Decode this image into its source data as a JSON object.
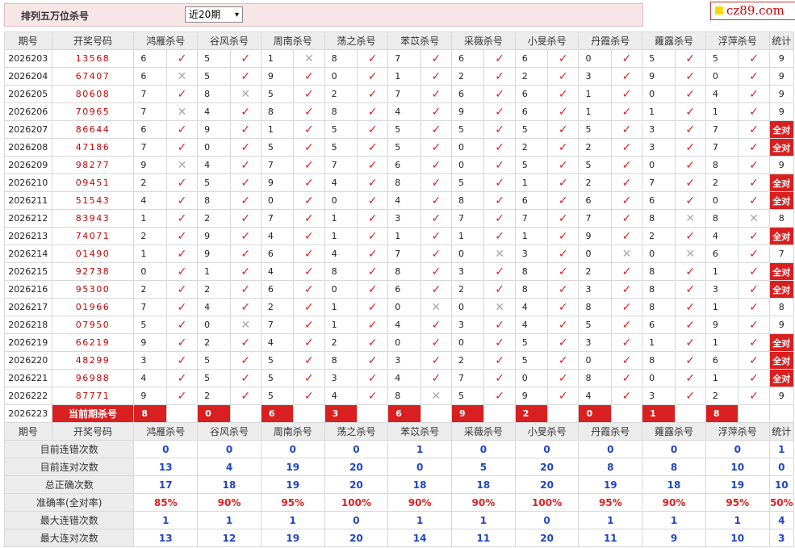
{
  "header": {
    "title": "排列五万位杀号",
    "period_select": "近20期",
    "logo_text": "cz89.com"
  },
  "columns": [
    "期号",
    "开奖号码",
    "鸿雁杀号",
    "谷风杀号",
    "周南杀号",
    "荡之杀号",
    "苯苡杀号",
    "采薇杀号",
    "小旻杀号",
    "丹霞杀号",
    "蕹露杀号",
    "浮萍杀号",
    "统计"
  ],
  "rows": [
    {
      "p": "2026203",
      "n": "13568",
      "k": [
        [
          6,
          1
        ],
        [
          5,
          1
        ],
        [
          1,
          0
        ],
        [
          8,
          1
        ],
        [
          7,
          1
        ],
        [
          6,
          1
        ],
        [
          6,
          1
        ],
        [
          0,
          1
        ],
        [
          5,
          1
        ],
        [
          5,
          1
        ]
      ],
      "s": "9"
    },
    {
      "p": "2026204",
      "n": "67407",
      "k": [
        [
          6,
          0
        ],
        [
          5,
          1
        ],
        [
          9,
          1
        ],
        [
          0,
          1
        ],
        [
          1,
          1
        ],
        [
          2,
          1
        ],
        [
          2,
          1
        ],
        [
          3,
          1
        ],
        [
          9,
          1
        ],
        [
          0,
          1
        ]
      ],
      "s": "9"
    },
    {
      "p": "2026205",
      "n": "80608",
      "k": [
        [
          7,
          1
        ],
        [
          8,
          0
        ],
        [
          5,
          1
        ],
        [
          2,
          1
        ],
        [
          7,
          1
        ],
        [
          6,
          1
        ],
        [
          6,
          1
        ],
        [
          1,
          1
        ],
        [
          0,
          1
        ],
        [
          4,
          1
        ]
      ],
      "s": "9"
    },
    {
      "p": "2026206",
      "n": "70965",
      "k": [
        [
          7,
          0
        ],
        [
          4,
          1
        ],
        [
          8,
          1
        ],
        [
          8,
          1
        ],
        [
          4,
          1
        ],
        [
          9,
          1
        ],
        [
          6,
          1
        ],
        [
          1,
          1
        ],
        [
          1,
          1
        ],
        [
          1,
          1
        ]
      ],
      "s": "9"
    },
    {
      "p": "2026207",
      "n": "86644",
      "k": [
        [
          6,
          1
        ],
        [
          9,
          1
        ],
        [
          1,
          1
        ],
        [
          5,
          1
        ],
        [
          5,
          1
        ],
        [
          5,
          1
        ],
        [
          5,
          1
        ],
        [
          5,
          1
        ],
        [
          3,
          1
        ],
        [
          7,
          1
        ]
      ],
      "s": "全对"
    },
    {
      "p": "2026208",
      "n": "47186",
      "k": [
        [
          7,
          1
        ],
        [
          0,
          1
        ],
        [
          5,
          1
        ],
        [
          5,
          1
        ],
        [
          5,
          1
        ],
        [
          0,
          1
        ],
        [
          2,
          1
        ],
        [
          2,
          1
        ],
        [
          3,
          1
        ],
        [
          7,
          1
        ]
      ],
      "s": "全对"
    },
    {
      "p": "2026209",
      "n": "98277",
      "k": [
        [
          9,
          0
        ],
        [
          4,
          1
        ],
        [
          7,
          1
        ],
        [
          7,
          1
        ],
        [
          6,
          1
        ],
        [
          0,
          1
        ],
        [
          5,
          1
        ],
        [
          5,
          1
        ],
        [
          0,
          1
        ],
        [
          8,
          1
        ]
      ],
      "s": "9"
    },
    {
      "p": "2026210",
      "n": "09451",
      "k": [
        [
          2,
          1
        ],
        [
          5,
          1
        ],
        [
          9,
          1
        ],
        [
          4,
          1
        ],
        [
          8,
          1
        ],
        [
          5,
          1
        ],
        [
          1,
          1
        ],
        [
          2,
          1
        ],
        [
          7,
          1
        ],
        [
          2,
          1
        ]
      ],
      "s": "全对"
    },
    {
      "p": "2026211",
      "n": "51543",
      "k": [
        [
          4,
          1
        ],
        [
          8,
          1
        ],
        [
          0,
          1
        ],
        [
          0,
          1
        ],
        [
          4,
          1
        ],
        [
          8,
          1
        ],
        [
          6,
          1
        ],
        [
          6,
          1
        ],
        [
          6,
          1
        ],
        [
          0,
          1
        ]
      ],
      "s": "全对"
    },
    {
      "p": "2026212",
      "n": "83943",
      "k": [
        [
          1,
          1
        ],
        [
          2,
          1
        ],
        [
          7,
          1
        ],
        [
          1,
          1
        ],
        [
          3,
          1
        ],
        [
          7,
          1
        ],
        [
          7,
          1
        ],
        [
          7,
          1
        ],
        [
          8,
          0
        ],
        [
          8,
          0
        ]
      ],
      "s": "8"
    },
    {
      "p": "2026213",
      "n": "74071",
      "k": [
        [
          2,
          1
        ],
        [
          9,
          1
        ],
        [
          4,
          1
        ],
        [
          1,
          1
        ],
        [
          1,
          1
        ],
        [
          1,
          1
        ],
        [
          1,
          1
        ],
        [
          9,
          1
        ],
        [
          2,
          1
        ],
        [
          4,
          1
        ]
      ],
      "s": "全对"
    },
    {
      "p": "2026214",
      "n": "01490",
      "k": [
        [
          1,
          1
        ],
        [
          9,
          1
        ],
        [
          6,
          1
        ],
        [
          4,
          1
        ],
        [
          7,
          1
        ],
        [
          0,
          0
        ],
        [
          3,
          1
        ],
        [
          0,
          0
        ],
        [
          0,
          0
        ],
        [
          6,
          1
        ]
      ],
      "s": "7"
    },
    {
      "p": "2026215",
      "n": "92738",
      "k": [
        [
          0,
          1
        ],
        [
          1,
          1
        ],
        [
          4,
          1
        ],
        [
          8,
          1
        ],
        [
          8,
          1
        ],
        [
          3,
          1
        ],
        [
          8,
          1
        ],
        [
          2,
          1
        ],
        [
          8,
          1
        ],
        [
          1,
          1
        ]
      ],
      "s": "全对"
    },
    {
      "p": "2026216",
      "n": "95300",
      "k": [
        [
          2,
          1
        ],
        [
          2,
          1
        ],
        [
          6,
          1
        ],
        [
          0,
          1
        ],
        [
          6,
          1
        ],
        [
          2,
          1
        ],
        [
          8,
          1
        ],
        [
          3,
          1
        ],
        [
          8,
          1
        ],
        [
          3,
          1
        ]
      ],
      "s": "全对"
    },
    {
      "p": "2026217",
      "n": "01966",
      "k": [
        [
          7,
          1
        ],
        [
          4,
          1
        ],
        [
          2,
          1
        ],
        [
          1,
          1
        ],
        [
          0,
          0
        ],
        [
          0,
          0
        ],
        [
          4,
          1
        ],
        [
          8,
          1
        ],
        [
          8,
          1
        ],
        [
          1,
          1
        ]
      ],
      "s": "8"
    },
    {
      "p": "2026218",
      "n": "07950",
      "k": [
        [
          5,
          1
        ],
        [
          0,
          0
        ],
        [
          7,
          1
        ],
        [
          1,
          1
        ],
        [
          4,
          1
        ],
        [
          3,
          1
        ],
        [
          4,
          1
        ],
        [
          5,
          1
        ],
        [
          6,
          1
        ],
        [
          9,
          1
        ]
      ],
      "s": "9"
    },
    {
      "p": "2026219",
      "n": "66219",
      "k": [
        [
          9,
          1
        ],
        [
          2,
          1
        ],
        [
          4,
          1
        ],
        [
          2,
          1
        ],
        [
          0,
          1
        ],
        [
          0,
          1
        ],
        [
          5,
          1
        ],
        [
          3,
          1
        ],
        [
          1,
          1
        ],
        [
          1,
          1
        ]
      ],
      "s": "全对"
    },
    {
      "p": "2026220",
      "n": "48299",
      "k": [
        [
          3,
          1
        ],
        [
          5,
          1
        ],
        [
          5,
          1
        ],
        [
          8,
          1
        ],
        [
          3,
          1
        ],
        [
          2,
          1
        ],
        [
          5,
          1
        ],
        [
          0,
          1
        ],
        [
          8,
          1
        ],
        [
          6,
          1
        ]
      ],
      "s": "全对"
    },
    {
      "p": "2026221",
      "n": "96988",
      "k": [
        [
          4,
          1
        ],
        [
          5,
          1
        ],
        [
          5,
          1
        ],
        [
          3,
          1
        ],
        [
          4,
          1
        ],
        [
          7,
          1
        ],
        [
          0,
          1
        ],
        [
          8,
          1
        ],
        [
          0,
          1
        ],
        [
          1,
          1
        ]
      ],
      "s": "全对"
    },
    {
      "p": "2026222",
      "n": "87771",
      "k": [
        [
          9,
          1
        ],
        [
          2,
          1
        ],
        [
          5,
          1
        ],
        [
          4,
          1
        ],
        [
          8,
          0
        ],
        [
          5,
          1
        ],
        [
          9,
          1
        ],
        [
          4,
          1
        ],
        [
          3,
          1
        ],
        [
          2,
          1
        ]
      ],
      "s": "9"
    }
  ],
  "current": {
    "period": "2026223",
    "label": "当前期杀号",
    "kills": [
      8,
      0,
      6,
      3,
      6,
      9,
      2,
      0,
      1,
      8
    ]
  },
  "summary": [
    {
      "label": "目前连错次数",
      "vals": [
        "0",
        "0",
        "0",
        "0",
        "1",
        "0",
        "0",
        "0",
        "0",
        "0",
        "1"
      ]
    },
    {
      "label": "目前连对次数",
      "vals": [
        "13",
        "4",
        "19",
        "20",
        "0",
        "5",
        "20",
        "8",
        "8",
        "10",
        "0"
      ]
    },
    {
      "label": "总正确次数",
      "vals": [
        "17",
        "18",
        "19",
        "20",
        "18",
        "18",
        "20",
        "19",
        "18",
        "19",
        "10"
      ]
    },
    {
      "label": "准确率(全对率)",
      "vals": [
        "85%",
        "90%",
        "95%",
        "100%",
        "90%",
        "90%",
        "100%",
        "95%",
        "90%",
        "95%",
        "50%"
      ]
    },
    {
      "label": "最大连错次数",
      "vals": [
        "1",
        "1",
        "1",
        "0",
        "1",
        "1",
        "0",
        "1",
        "1",
        "1",
        "4"
      ]
    },
    {
      "label": "最大连对次数",
      "vals": [
        "13",
        "12",
        "19",
        "20",
        "14",
        "11",
        "20",
        "11",
        "9",
        "10",
        "3"
      ]
    }
  ],
  "icons": {
    "correct": "check-icon",
    "wrong": "cross-icon"
  },
  "colors": {
    "accent": "#d92020",
    "header_bg": "#ececec",
    "summary_value": "#1f45c8"
  }
}
